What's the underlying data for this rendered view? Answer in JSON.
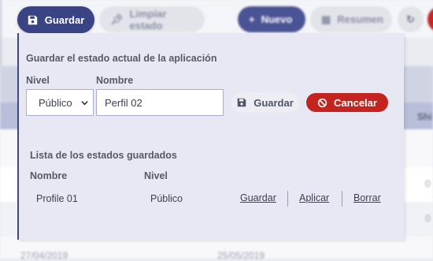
{
  "toolbar": {
    "save_label": "Guardar",
    "clear_label": "Limpiar estado",
    "new_label": "Nuevo",
    "summary_label": "Resumen"
  },
  "background": {
    "header_partial": "Shi",
    "rows": [
      {
        "date1": "",
        "date2": "",
        "tail": "0"
      },
      {
        "date1": "",
        "date2": "",
        "tail": "0"
      },
      {
        "date1": "27/04/2019",
        "date2": "25/05/2019",
        "tail": ""
      }
    ]
  },
  "panel": {
    "title": "Guardar el estado actual de la aplicación",
    "level_label": "Nivel",
    "name_label": "Nombre",
    "level_value": "Público",
    "name_value": "Perfil 02",
    "save_label": "Guardar",
    "cancel_label": "Cancelar"
  },
  "saved_list": {
    "title": "Lista de los estados guardados",
    "col_name": "Nombre",
    "col_level": "Nivel",
    "items": [
      {
        "name": "Profile 01",
        "level": "Público",
        "actions": [
          "Guardar",
          "Aplicar",
          "Borrar"
        ]
      }
    ]
  },
  "colors": {
    "primary": "#3a4383",
    "danger": "#c4241f",
    "panel_bg": "#e7e8f3"
  }
}
